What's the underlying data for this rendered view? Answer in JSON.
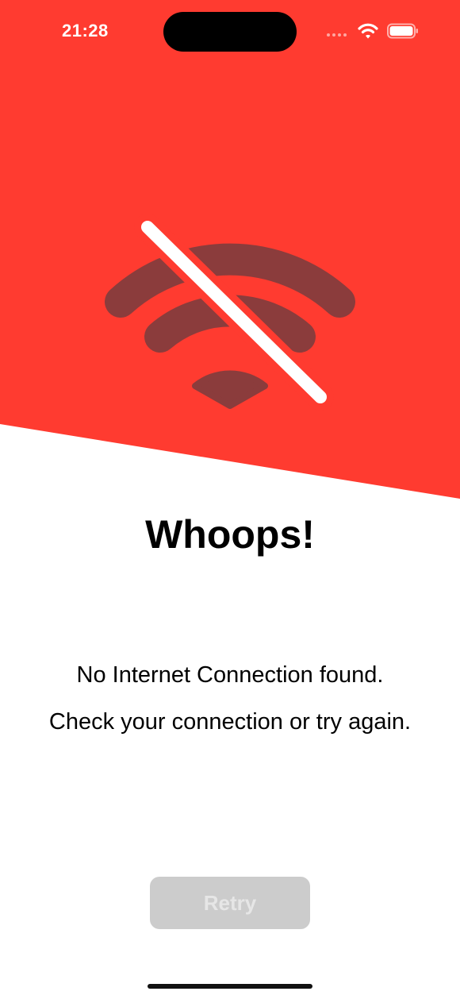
{
  "theme": {
    "accent": "#FF3B30",
    "icon_color": "#8B3C3C",
    "slash_color": "#FFFFFF",
    "button_disabled": "#CCCCCC"
  },
  "status_bar": {
    "time": "21:28",
    "icons": [
      "signal-dots-icon",
      "wifi-icon",
      "battery-icon"
    ]
  },
  "hero": {
    "icon": "wifi-off-icon"
  },
  "content": {
    "title": "Whoops!",
    "message_line_1": "No Internet Connection found.",
    "message_line_2": "Check your connection or try again."
  },
  "actions": {
    "retry_label": "Retry",
    "retry_enabled": false
  }
}
